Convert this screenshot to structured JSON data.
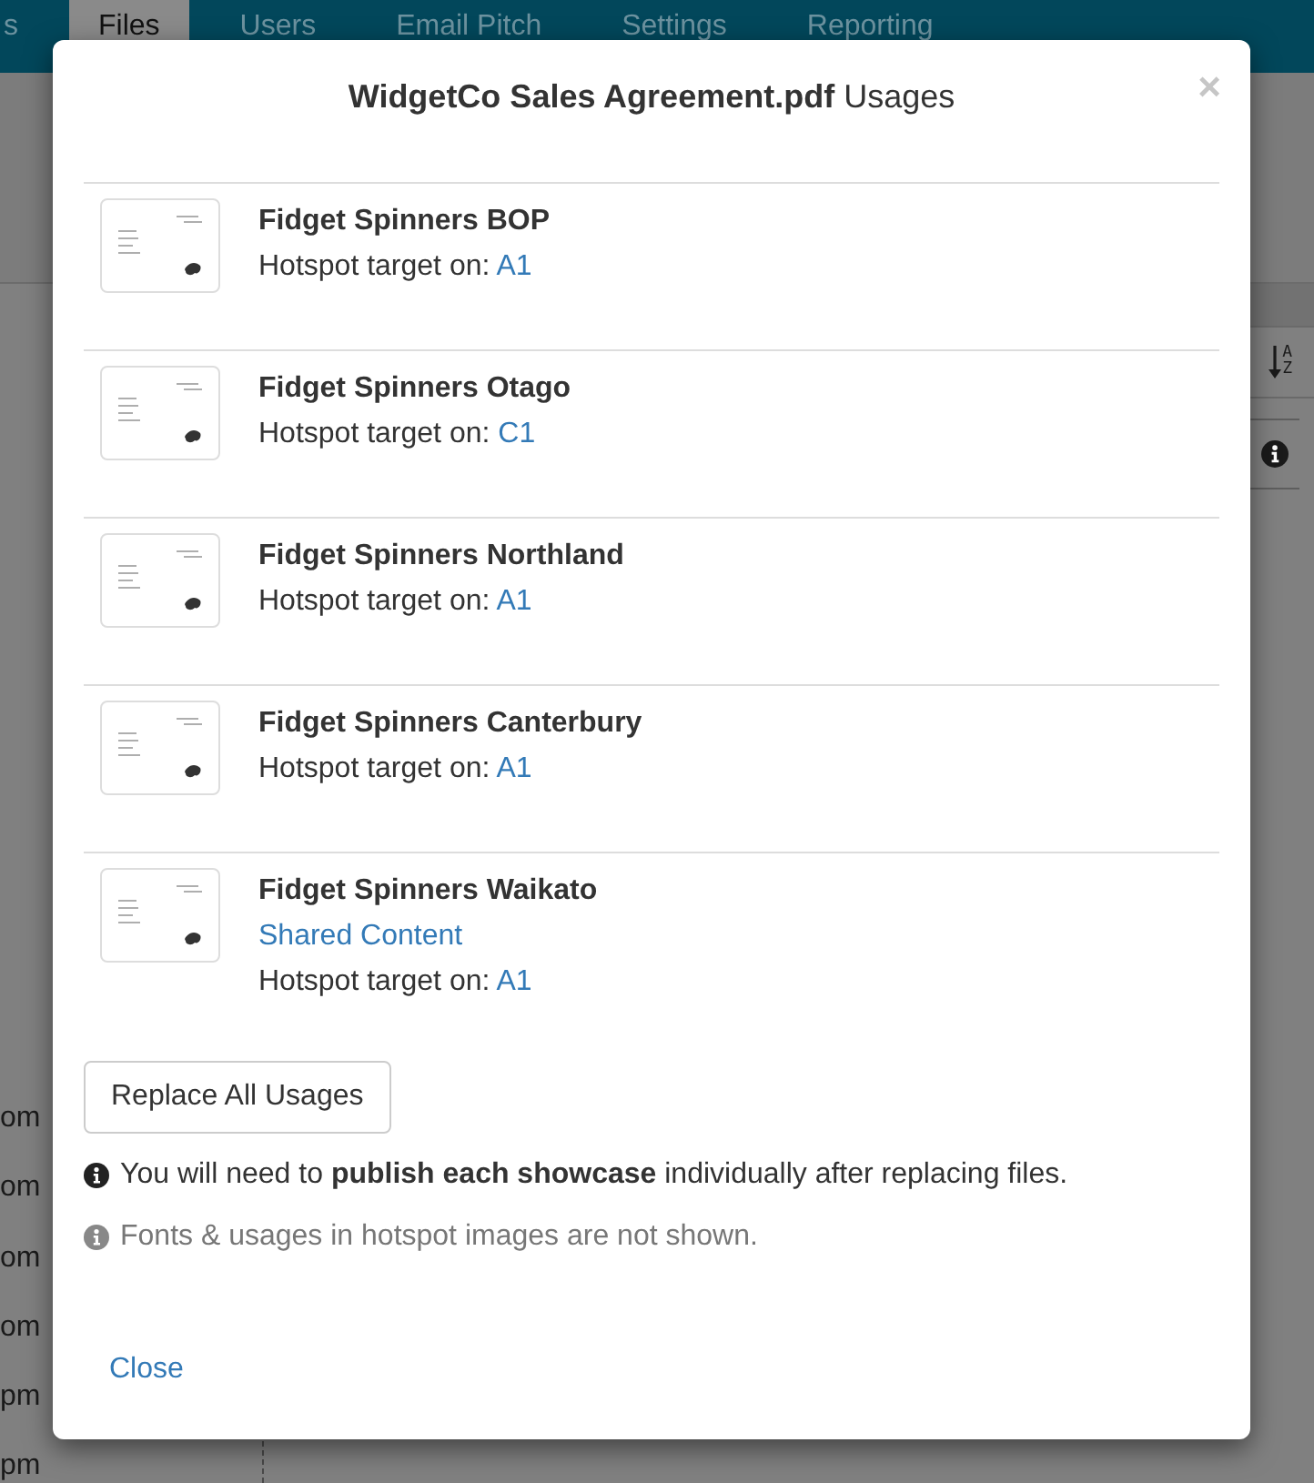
{
  "nav": {
    "tabs": [
      {
        "label": "s",
        "selected": false
      },
      {
        "label": "Files",
        "selected": true
      },
      {
        "label": "Users",
        "selected": false
      },
      {
        "label": "Email Pitch",
        "selected": false
      },
      {
        "label": "Settings",
        "selected": false
      },
      {
        "label": "Reporting",
        "selected": false
      }
    ]
  },
  "background_list": {
    "times": [
      "om",
      "om",
      "om",
      "om",
      "pm",
      "pm"
    ]
  },
  "toolbar": {
    "sort_letters": [
      "A",
      "Z"
    ]
  },
  "modal": {
    "title": "**WidgetCo Sales Agreement.pdf** Usages",
    "close_glyph": "×",
    "usages": [
      {
        "name": "Fidget Spinners BOP",
        "hotspot_label": "Hotspot target on:",
        "target": "A1"
      },
      {
        "name": "Fidget Spinners Otago",
        "hotspot_label": "Hotspot target on:",
        "target": "C1"
      },
      {
        "name": "Fidget Spinners Northland",
        "hotspot_label": "Hotspot target on:",
        "target": "A1"
      },
      {
        "name": "Fidget Spinners Canterbury",
        "hotspot_label": "Hotspot target on:",
        "target": "A1"
      },
      {
        "name": "Fidget Spinners Waikato",
        "shared_content": "Shared Content",
        "hotspot_label": "Hotspot target on:",
        "target": "A1"
      }
    ],
    "replace_button": "Replace All Usages",
    "notes": [
      {
        "kind": "info",
        "text": "You will need to **publish each showcase** individually after replacing files."
      },
      {
        "kind": "muted",
        "text": "Fonts & usages in hotspot images are not shown."
      }
    ],
    "footer_link": "Close"
  }
}
